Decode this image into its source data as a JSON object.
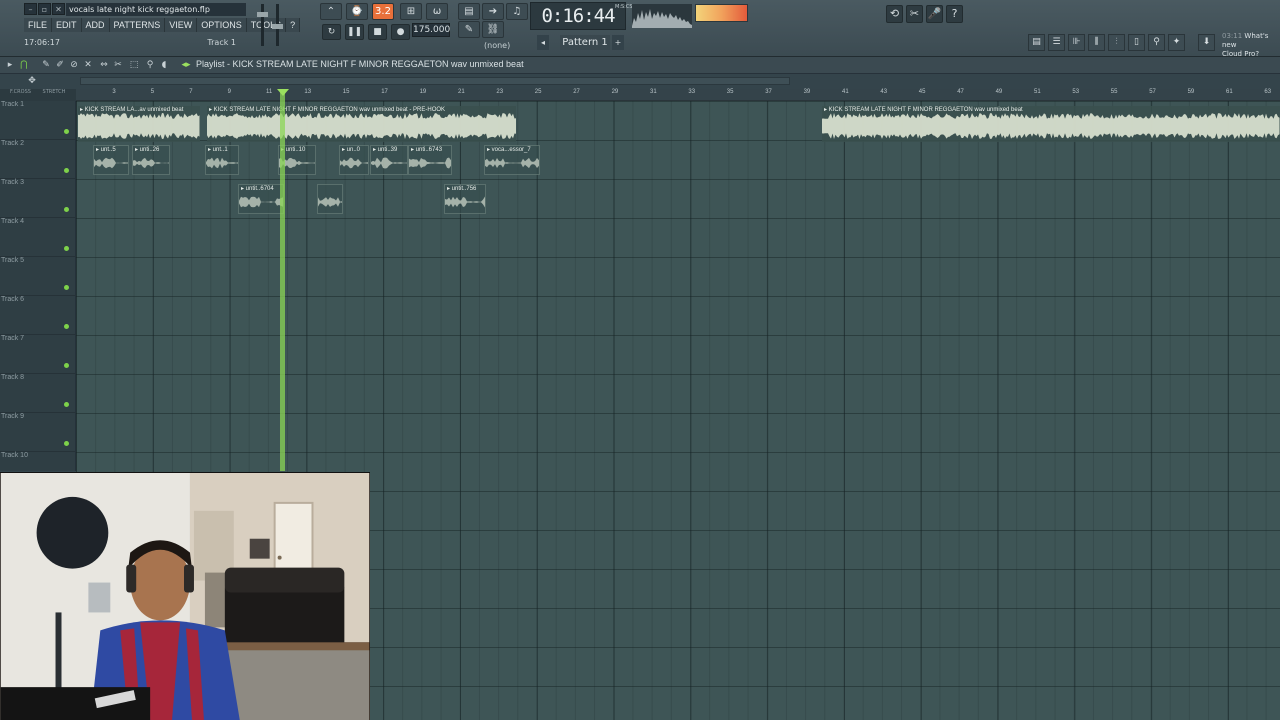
{
  "window": {
    "file_title": "vocals late night kick reggaeton.flp",
    "menu": [
      "FILE",
      "EDIT",
      "ADD",
      "PATTERNS",
      "VIEW",
      "OPTIONS",
      "TOOLS",
      "?"
    ],
    "hint_time": "17:06:17",
    "hint_track": "Track 1"
  },
  "transport": {
    "snap_label": "3.2",
    "tempo": "175.000",
    "time": "0:16:44",
    "time_unit": "M:S:CS",
    "pattern": "Pattern 1",
    "none_label": "(none)"
  },
  "news": {
    "time": "03:11",
    "text": "What's new",
    "sub": "Cloud Pro?"
  },
  "playlist": {
    "title": "Playlist - KICK STREAM LATE NIGHT F MINOR REGGAETON wav unmixed beat",
    "header_labels": [
      "F.CROSS",
      "STRETCH"
    ],
    "bar_numbers": [
      3,
      5,
      7,
      9,
      11,
      13,
      15,
      17,
      19,
      21,
      23,
      25,
      27,
      29,
      31,
      33,
      35,
      37,
      39,
      41,
      43,
      45,
      47,
      49,
      51,
      53,
      55,
      57,
      59,
      61,
      63
    ],
    "tracks": [
      "Track 1",
      "Track 2",
      "Track 3",
      "Track 4",
      "Track 5",
      "Track 6",
      "Track 7",
      "Track 8",
      "Track 9",
      "Track 10"
    ],
    "clips": [
      {
        "label": "KICK STREAM LA...av unmixed beat",
        "track": 1
      },
      {
        "label": "KICK STREAM LATE NIGHT F MINOR REGGAETON wav unmixed beat - PRE-HOOK",
        "track": 1
      },
      {
        "label": "KICK STREAM LATE NIGHT F MINOR REGGAETON wav unmixed beat",
        "track": 1
      },
      {
        "label": "unt..5",
        "track": 2
      },
      {
        "label": "unti..26",
        "track": 2
      },
      {
        "label": "unt..1",
        "track": 2
      },
      {
        "label": "unti..10",
        "track": 2
      },
      {
        "label": "un..0",
        "track": 2
      },
      {
        "label": "unti..39",
        "track": 2
      },
      {
        "label": "unti..6743",
        "track": 2
      },
      {
        "label": "voca...essor_7",
        "track": 2
      },
      {
        "label": "untit..6704",
        "track": 3
      },
      {
        "label": "",
        "track": 3
      },
      {
        "label": "untit..756",
        "track": 3
      }
    ]
  },
  "colors": {
    "playhead": "#8bd656",
    "grid": "#3e5556",
    "accent_orange": "#e8703a",
    "led_green": "#7ed24a"
  },
  "icons": [
    "pencil-icon",
    "brush-icon",
    "delete-icon",
    "mute-icon",
    "slip-icon",
    "slice-icon",
    "select-icon",
    "zoom-icon",
    "playback-icon",
    "magnet-icon"
  ]
}
